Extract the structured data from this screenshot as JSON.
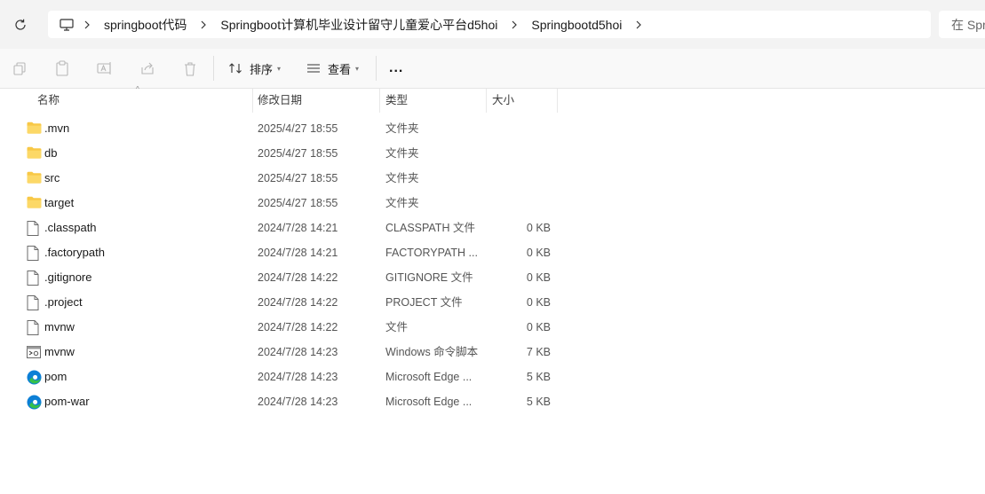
{
  "address_bar": {
    "breadcrumbs": [
      "springboot代码",
      "Springboot计算机毕业设计留守儿童爱心平台d5hoi",
      "Springbootd5hoi"
    ],
    "search_placeholder": "在 Spr"
  },
  "command_bar": {
    "sort_label": "排序",
    "view_label": "查看",
    "more_label": "..."
  },
  "columns": {
    "name": "名称",
    "date": "修改日期",
    "type": "类型",
    "size": "大小"
  },
  "files": [
    {
      "name": ".mvn",
      "date": "2025/4/27 18:55",
      "type": "文件夹",
      "size": "",
      "icon": "folder-icon"
    },
    {
      "name": "db",
      "date": "2025/4/27 18:55",
      "type": "文件夹",
      "size": "",
      "icon": "folder-icon"
    },
    {
      "name": "src",
      "date": "2025/4/27 18:55",
      "type": "文件夹",
      "size": "",
      "icon": "folder-icon"
    },
    {
      "name": "target",
      "date": "2025/4/27 18:55",
      "type": "文件夹",
      "size": "",
      "icon": "folder-icon"
    },
    {
      "name": ".classpath",
      "date": "2024/7/28 14:21",
      "type": "CLASSPATH 文件",
      "size": "0 KB",
      "icon": "file-icon"
    },
    {
      "name": ".factorypath",
      "date": "2024/7/28 14:21",
      "type": "FACTORYPATH ...",
      "size": "0 KB",
      "icon": "file-icon"
    },
    {
      "name": ".gitignore",
      "date": "2024/7/28 14:22",
      "type": "GITIGNORE 文件",
      "size": "0 KB",
      "icon": "file-icon"
    },
    {
      "name": ".project",
      "date": "2024/7/28 14:22",
      "type": "PROJECT 文件",
      "size": "0 KB",
      "icon": "file-icon"
    },
    {
      "name": "mvnw",
      "date": "2024/7/28 14:22",
      "type": "文件",
      "size": "0 KB",
      "icon": "file-icon"
    },
    {
      "name": "mvnw",
      "date": "2024/7/28 14:23",
      "type": "Windows 命令脚本",
      "size": "7 KB",
      "icon": "script-icon"
    },
    {
      "name": "pom",
      "date": "2024/7/28 14:23",
      "type": "Microsoft Edge ...",
      "size": "5 KB",
      "icon": "edge-icon"
    },
    {
      "name": "pom-war",
      "date": "2024/7/28 14:23",
      "type": "Microsoft Edge ...",
      "size": "5 KB",
      "icon": "edge-icon"
    }
  ],
  "colors": {
    "folder": "#f8c846",
    "edge_blue": "#0c7fd6",
    "edge_green": "#35c04a"
  }
}
